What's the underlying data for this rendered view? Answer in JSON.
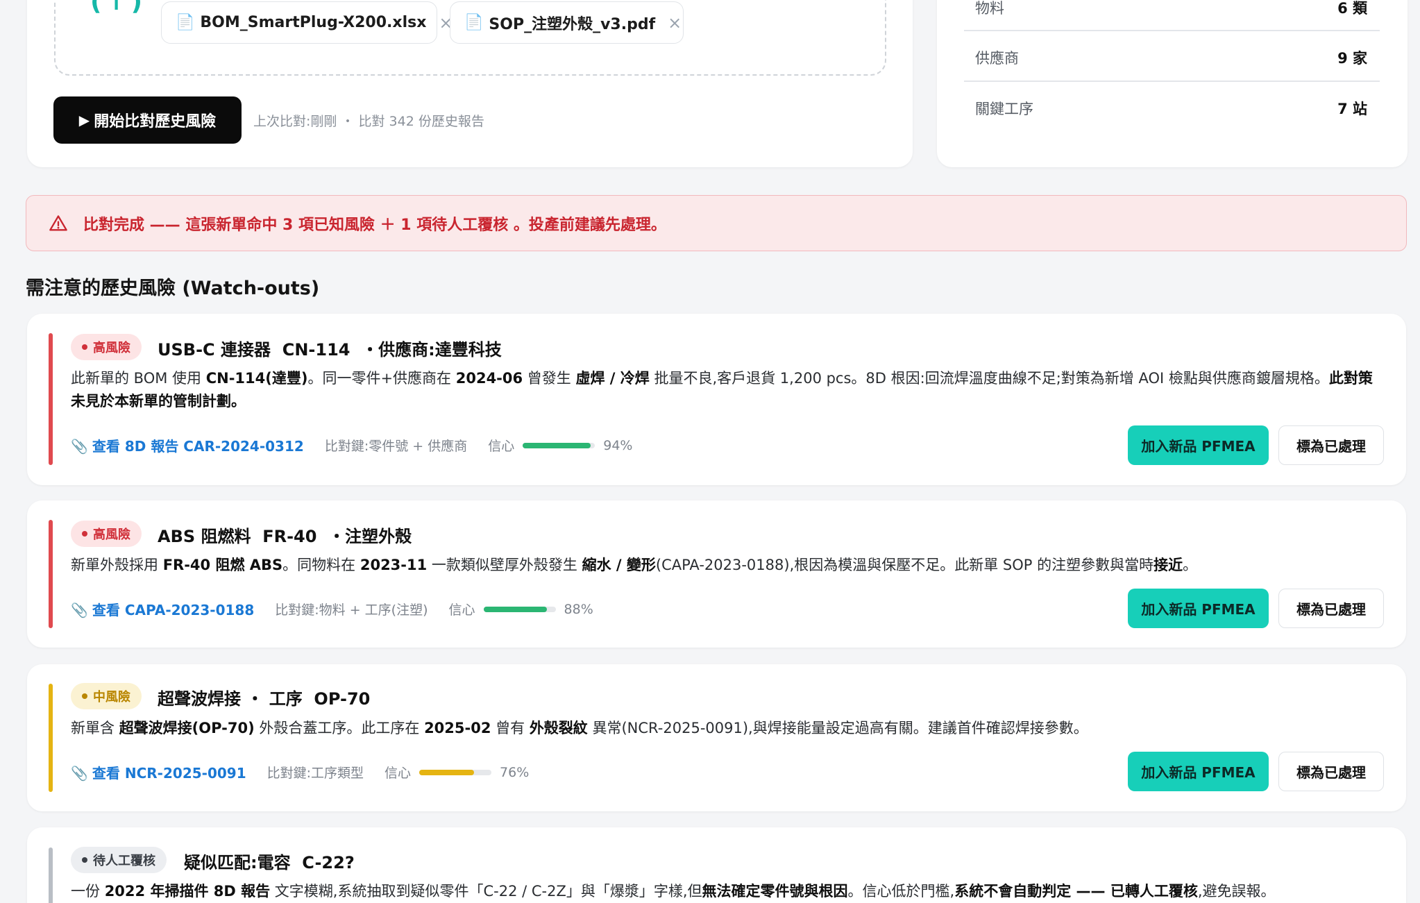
{
  "upload": {
    "files": [
      {
        "name": "BOM_SmartPlug-X200.xlsx",
        "icon": "document-icon",
        "remove": "×"
      },
      {
        "name": "SOP_注塑外殼_v3.pdf",
        "icon": "document-icon",
        "remove": "×"
      }
    ],
    "upload_icon": "(↑)",
    "start_button": "開始比對歷史風險",
    "last_compare": "上次比對:剛剛 ・ 比對 342 份歷史報告"
  },
  "stats": [
    {
      "label": "物料",
      "value": "6 類"
    },
    {
      "label": "供應商",
      "value": "9 家"
    },
    {
      "label": "關鍵工序",
      "value": "7 站"
    }
  ],
  "alert": {
    "part1": "比對完成 —— 這張新單命中 ",
    "part2": "3 項已知風險",
    "part3": " ＋ ",
    "part4": "1 項待人工覆核",
    "part5": " 。投產前建議先處理。",
    "icon": "warning-icon"
  },
  "section_title": "需注意的歷史風險 (Watch-outs)",
  "risks": [
    {
      "level": "高風險",
      "title": "USB-C 連接器  CN-114  ・供應商:達豐科技",
      "desc": [
        {
          "t": "此新單的 BOM 使用 ",
          "b": false
        },
        {
          "t": "CN-114(達豐)",
          "b": true
        },
        {
          "t": "。同一零件+供應商在 ",
          "b": false
        },
        {
          "t": "2024-06",
          "b": true
        },
        {
          "t": " 曾發生 ",
          "b": false
        },
        {
          "t": "虛焊 / 冷焊",
          "b": true
        },
        {
          "t": " 批量不良,客戶退貨 1,200 pcs。8D 根因:回流焊溫度曲線不足;對策為新增 AOI 檢點與供應商鍍層規格。",
          "b": false
        },
        {
          "t": "此對策未見於本新單的管制計劃。",
          "b": true
        }
      ],
      "link": "查看 8D 報告 CAR-2024-0312",
      "key": "比對鍵:零件號 + 供應商",
      "conf_label": "信心",
      "confidence": 94,
      "conf_text": "94%",
      "pfmea": "加入新品 PFMEA",
      "done": "標為已處理"
    },
    {
      "level": "高風險",
      "title": "ABS 阻燃料  FR-40  ・注塑外殼",
      "desc": [
        {
          "t": "新單外殼採用 ",
          "b": false
        },
        {
          "t": "FR-40 阻燃 ABS",
          "b": true
        },
        {
          "t": "。同物料在 ",
          "b": false
        },
        {
          "t": "2023-11",
          "b": true
        },
        {
          "t": " 一款類似壁厚外殼發生 ",
          "b": false
        },
        {
          "t": "縮水 / 變形",
          "b": true
        },
        {
          "t": "(CAPA-2023-0188),根因為模溫與保壓不足。此新單 SOP 的注塑參數與當時",
          "b": false
        },
        {
          "t": "接近",
          "b": true
        },
        {
          "t": "。",
          "b": false
        }
      ],
      "link": "查看 CAPA-2023-0188",
      "key": "比對鍵:物料 + 工序(注塑)",
      "conf_label": "信心",
      "confidence": 88,
      "conf_text": "88%",
      "pfmea": "加入新品 PFMEA",
      "done": "標為已處理"
    },
    {
      "level": "中風險",
      "title": "超聲波焊接 ・ 工序  OP-70",
      "desc": [
        {
          "t": "新單含 ",
          "b": false
        },
        {
          "t": "超聲波焊接(OP-70)",
          "b": true
        },
        {
          "t": " 外殼合蓋工序。此工序在 ",
          "b": false
        },
        {
          "t": "2025-02",
          "b": true
        },
        {
          "t": " 曾有 ",
          "b": false
        },
        {
          "t": "外殼裂紋",
          "b": true
        },
        {
          "t": " 異常(NCR-2025-0091),與焊接能量設定過高有關。建議首件確認焊接參數。",
          "b": false
        }
      ],
      "link": "查看 NCR-2025-0091",
      "key": "比對鍵:工序類型",
      "conf_label": "信心",
      "confidence": 76,
      "conf_text": "76%",
      "pfmea": "加入新品 PFMEA",
      "done": "標為已處理"
    },
    {
      "level": "待人工覆核",
      "title": "疑似匹配:電容  C-22?",
      "desc": [
        {
          "t": "一份 ",
          "b": false
        },
        {
          "t": "2022 年掃描件 8D 報告",
          "b": true
        },
        {
          "t": " 文字模糊,系統抽取到疑似零件「C-22 / C-2Z」與「爆漿」字樣,但",
          "b": false
        },
        {
          "t": "無法確定零件號與根因",
          "b": true
        },
        {
          "t": "。信心低於門檻,",
          "b": false
        },
        {
          "t": "系統不會自動判定 —— 已轉人工覆核",
          "b": true
        },
        {
          "t": ",避免誤報。",
          "b": false
        }
      ]
    }
  ],
  "colors": {
    "high": "#d0303a",
    "mid": "#e5b412",
    "pending": "#b9bec5",
    "accent": "#17cfb9",
    "link": "#1a78d4",
    "conf_green": "#2bb673"
  }
}
